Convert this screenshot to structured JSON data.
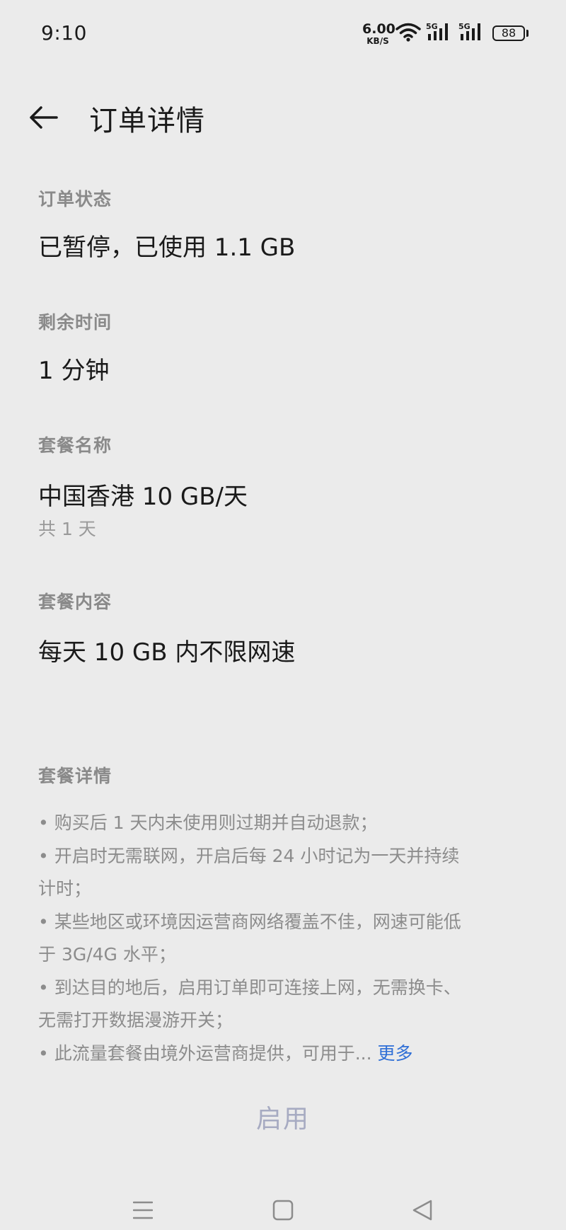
{
  "status_bar": {
    "time": "9:10",
    "net_speed_value": "6.00",
    "net_speed_unit": "KB/S",
    "signal_1_label": "5G",
    "signal_2_label": "5G",
    "battery": "88"
  },
  "header": {
    "title": "订单详情"
  },
  "sections": {
    "order_status": {
      "label": "订单状态",
      "value": "已暂停，已使用 1.1 GB"
    },
    "remaining_time": {
      "label": "剩余时间",
      "value": "1 分钟"
    },
    "plan_name": {
      "label": "套餐名称",
      "value": "中国香港 10 GB/天",
      "sub": "共 1 天"
    },
    "plan_content": {
      "label": "套餐内容",
      "value": "每天 10 GB 内不限网速"
    }
  },
  "plan_details": {
    "label": "套餐详情",
    "lines": [
      "• 购买后 1 天内未使用则过期并自动退款；",
      "• 开启时无需联网，开启后每 24 小时记为一天并持续",
      "计时；",
      "• 某些地区或环境因运营商网络覆盖不佳，网速可能低",
      "于 3G/4G 水平；",
      "• 到达目的地后，启用订单即可连接上网，无需换卡、",
      "无需打开数据漫游开关；",
      "• 此流量套餐由境外运营商提供，可用于..."
    ],
    "more_label": "更多"
  },
  "actions": {
    "enable_label": "启用"
  },
  "colors": {
    "background": "#ebebeb",
    "link": "#2f6fd6",
    "disabled_button_text": "#a7abc2"
  }
}
